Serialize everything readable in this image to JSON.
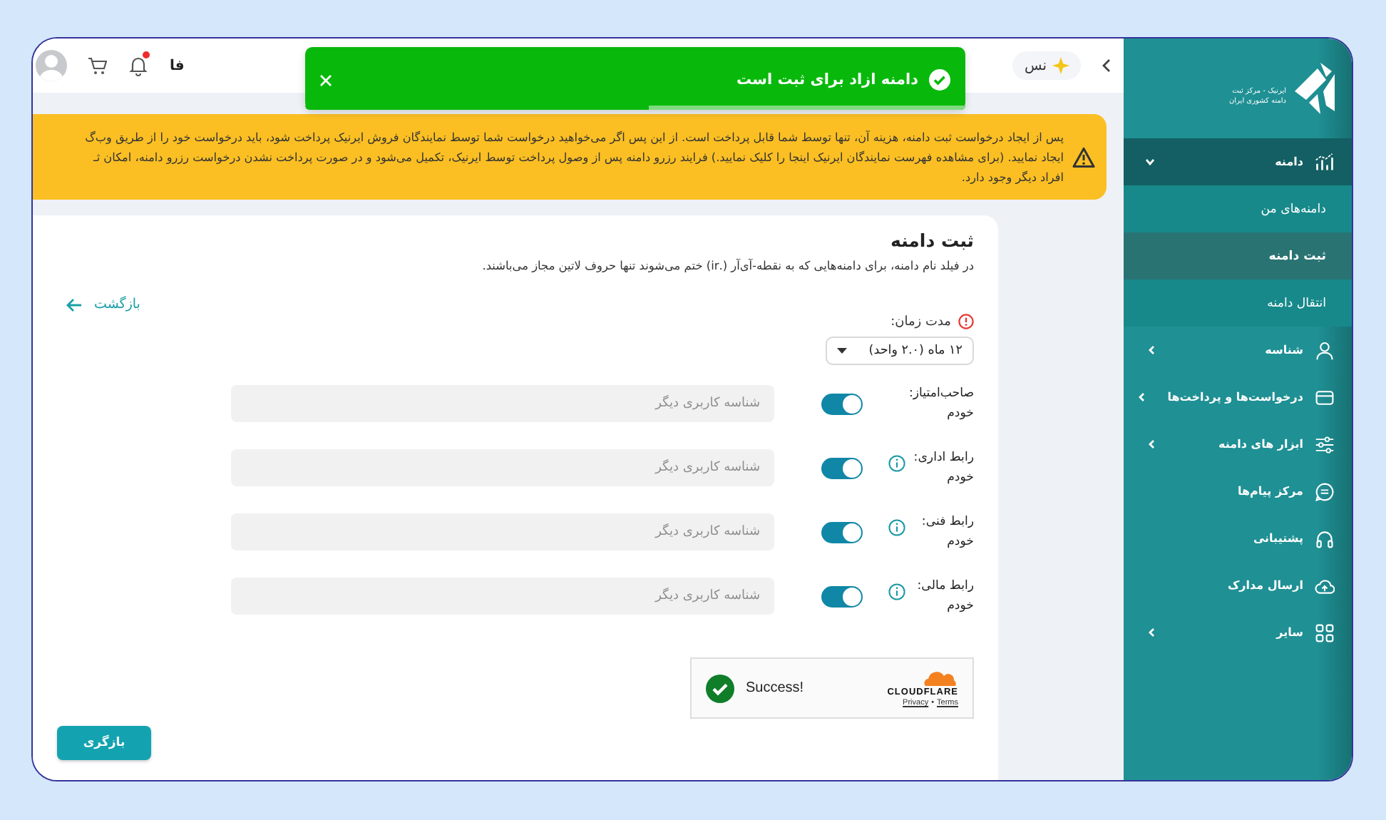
{
  "topbar": {
    "language": "فا",
    "unread": true,
    "pill_text": "نس"
  },
  "toast": {
    "message": "دامنه ازاد برای ثبت است",
    "level": 0.48
  },
  "banner": {
    "lines": [
      "پس از ایجاد درخواست ثبت دامنه، هزینه آن، تنها توسط شما قابل پرداخت است. از این پس اگر می‌خواهید درخواست شما توسط نمایندگان فروش ایرنیک پرداخت شود، باید درخواست خود را از طریق وب‌گ",
      "ایجاد نمایید. (برای مشاهده فهرست نمایندگان ایرنیک اینجا را کلیک نمایید.) فرایند رزرو دامنه پس از وصول پرداخت توسط ایرنیک، تکمیل می‌شود و در صورت پرداخت نشدن درخواست رزرو دامنه، امکان ثـ",
      "افراد دیگر وجود دارد."
    ]
  },
  "form": {
    "title": "ثبت دامنه",
    "subtitle": "در فیلد نام دامنه، برای دامنه‌هایی که به نقطه-آی‌آر (.ir) ختم می‌شوند تنها حروف لاتین مجاز می‌باشند.",
    "back_link": "بازگشت",
    "duration": {
      "label": "مدت زمان:",
      "value": "۱۲ ماه (۲.۰ واحد)"
    },
    "contacts": [
      {
        "label": "صاحب‌امتیاز:",
        "value": "خودم",
        "info": false,
        "on": true,
        "placeholder": "شناسه کاربری دیگر"
      },
      {
        "label": "رابط اداری:",
        "value": "خودم",
        "info": true,
        "on": true,
        "placeholder": "شناسه کاربری دیگر"
      },
      {
        "label": "رابط فنی:",
        "value": "خودم",
        "info": true,
        "on": true,
        "placeholder": "شناسه کاربری دیگر"
      },
      {
        "label": "رابط مالی:",
        "value": "خودم",
        "info": true,
        "on": true,
        "placeholder": "شناسه کاربری دیگر"
      }
    ],
    "captcha": {
      "status": "Success!",
      "brand": "CLOUDFLARE",
      "privacy": "Privacy",
      "separator": "•",
      "terms": "Terms"
    },
    "submit": "بازگری"
  },
  "sidebar": {
    "logo_lines": [
      "ایرنیک - مرکز ثبت",
      "دامنه کشوری ایران"
    ],
    "items": [
      {
        "label": "دامنه",
        "kind": "chart",
        "submenu": true,
        "expanded": true,
        "children": [
          {
            "label": "دامنه‌های من",
            "selected": false
          },
          {
            "label": "ثبت دامنه",
            "selected": true
          },
          {
            "label": "انتقال دامنه",
            "selected": false
          }
        ]
      },
      {
        "label": "شناسه",
        "kind": "person",
        "submenu": true,
        "expanded": false
      },
      {
        "label": "درخواست‌ها و پرداخت‌ها",
        "kind": "card",
        "submenu": true,
        "expanded": false
      },
      {
        "label": "ابزار های دامنه",
        "kind": "sliders",
        "submenu": true,
        "expanded": false
      },
      {
        "label": "مرکز پیام‌ها",
        "kind": "message",
        "submenu": false,
        "expanded": false
      },
      {
        "label": "پشتیبانی",
        "kind": "headset",
        "submenu": false,
        "expanded": false
      },
      {
        "label": "ارسال مدارک",
        "kind": "upload",
        "submenu": false,
        "expanded": false
      },
      {
        "label": "سایر",
        "kind": "grid",
        "submenu": true,
        "expanded": false
      }
    ]
  }
}
